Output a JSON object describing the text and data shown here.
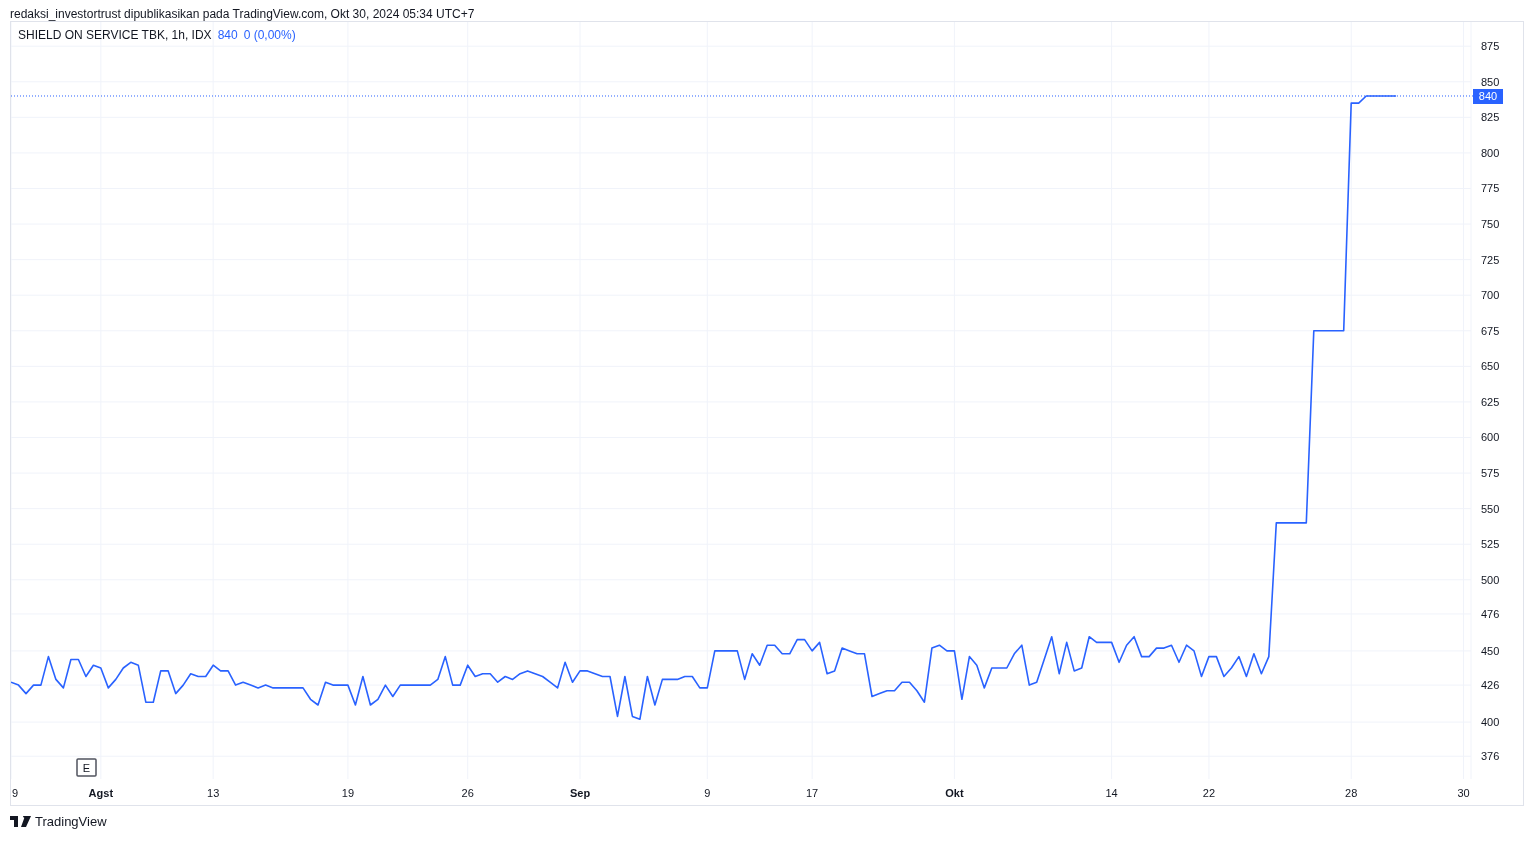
{
  "attribution": "redaksi_investortrust dipublikasikan pada TradingView.com, Okt 30, 2024 05:34 UTC+7",
  "legend": {
    "symbol": "SHIELD ON SERVICE TBK, 1h, IDX",
    "price": "840",
    "change": "0 (0,00%)"
  },
  "event_marker": "E",
  "chart_data": {
    "type": "line",
    "grid": true,
    "ref_lines": [
      {
        "axis": "y",
        "value": 840,
        "label": "840"
      }
    ],
    "ylim": [
      360,
      892
    ],
    "yticks": [
      875,
      850,
      825,
      800,
      775,
      750,
      725,
      700,
      675,
      650,
      625,
      600,
      575,
      550,
      525,
      500,
      476,
      450,
      426,
      400,
      376
    ],
    "categories": [
      "9",
      null,
      null,
      null,
      null,
      null,
      null,
      null,
      null,
      null,
      null,
      null,
      "Agst",
      null,
      null,
      null,
      null,
      null,
      null,
      null,
      null,
      null,
      null,
      null,
      null,
      null,
      null,
      "13",
      null,
      null,
      null,
      null,
      null,
      null,
      null,
      null,
      null,
      null,
      null,
      null,
      null,
      null,
      null,
      null,
      null,
      "19",
      null,
      null,
      null,
      null,
      null,
      null,
      null,
      null,
      null,
      null,
      null,
      null,
      null,
      null,
      null,
      "26",
      null,
      null,
      null,
      null,
      null,
      null,
      null,
      null,
      null,
      null,
      null,
      null,
      null,
      null,
      "Sep",
      null,
      null,
      null,
      null,
      null,
      null,
      null,
      null,
      null,
      null,
      null,
      null,
      null,
      null,
      null,
      null,
      "9",
      null,
      null,
      null,
      null,
      null,
      null,
      null,
      null,
      null,
      null,
      null,
      null,
      null,
      "17",
      null,
      null,
      null,
      null,
      null,
      null,
      null,
      null,
      null,
      null,
      null,
      null,
      null,
      null,
      null,
      null,
      null,
      null,
      "Okt",
      null,
      null,
      null,
      null,
      null,
      null,
      null,
      null,
      null,
      null,
      null,
      null,
      null,
      null,
      null,
      null,
      null,
      null,
      null,
      null,
      "14",
      null,
      null,
      null,
      null,
      null,
      null,
      null,
      null,
      null,
      null,
      null,
      null,
      "22",
      null,
      null,
      null,
      null,
      null,
      null,
      null,
      null,
      null,
      null,
      null,
      null,
      null,
      null,
      null,
      null,
      null,
      null,
      "28",
      null,
      null,
      null,
      null,
      null,
      null,
      null,
      null,
      null,
      null,
      null,
      null,
      null,
      null,
      "30",
      null
    ],
    "series": [
      {
        "color": "#2962ff",
        "values": [
          428,
          426,
          420,
          426,
          426,
          446,
          430,
          424,
          444,
          444,
          432,
          440,
          438,
          424,
          430,
          438,
          442,
          440,
          414,
          414,
          436,
          436,
          420,
          426,
          434,
          432,
          432,
          440,
          436,
          436,
          426,
          428,
          426,
          424,
          426,
          424,
          424,
          424,
          424,
          424,
          416,
          412,
          428,
          426,
          426,
          426,
          412,
          432,
          412,
          416,
          426,
          418,
          426,
          426,
          426,
          426,
          426,
          430,
          446,
          426,
          426,
          440,
          432,
          434,
          434,
          428,
          432,
          430,
          434,
          436,
          434,
          432,
          428,
          424,
          442,
          428,
          436,
          436,
          434,
          432,
          432,
          404,
          432,
          404,
          402,
          432,
          412,
          430,
          430,
          430,
          432,
          432,
          424,
          424,
          450,
          450,
          450,
          450,
          430,
          448,
          440,
          454,
          454,
          448,
          448,
          458,
          458,
          450,
          456,
          434,
          436,
          452,
          450,
          448,
          448,
          418,
          420,
          422,
          422,
          428,
          428,
          422,
          414,
          452,
          454,
          450,
          450,
          416,
          446,
          440,
          424,
          438,
          438,
          438,
          448,
          454,
          426,
          428,
          444,
          460,
          434,
          456,
          436,
          438,
          460,
          456,
          456,
          456,
          442,
          454,
          460,
          446,
          446,
          452,
          452,
          454,
          442,
          454,
          450,
          432,
          446,
          446,
          432,
          438,
          446,
          432,
          448,
          434,
          446,
          540,
          540,
          540,
          540,
          540,
          675,
          675,
          675,
          675,
          675,
          835,
          835,
          840,
          840,
          840,
          840,
          840,
          null,
          null,
          null,
          null,
          null,
          null,
          null,
          null,
          null,
          null
        ]
      }
    ]
  },
  "footer": {
    "brand": "TradingView"
  }
}
